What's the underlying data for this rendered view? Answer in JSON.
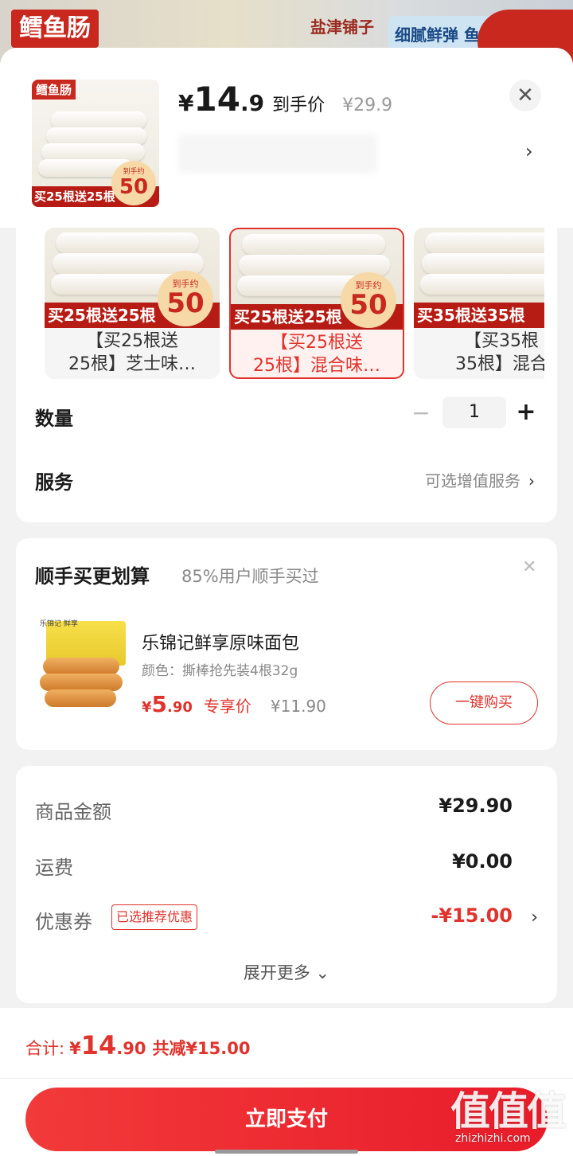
{
  "background": {
    "brand_label": "鳕鱼肠",
    "logo_text": "盐津铺子",
    "tag_text": "细腻鲜弹 鱼"
  },
  "header": {
    "thumb_brand": "鳕鱼肠",
    "thumb_promo": "买25根送25根",
    "thumb_circle_small": "到手约",
    "thumb_circle_big": "50",
    "price_currency": "¥",
    "price_int": "14",
    "price_dec": ".9",
    "price_label": "到手价",
    "original_price": "¥29.9",
    "close_icon": "✕",
    "chevron_icon": "›"
  },
  "sku_options": [
    {
      "promo": "买25根送25根",
      "circle_small": "到手约",
      "circle_big": "50",
      "name": "【买25根送\n25根】芝士味…",
      "selected": false
    },
    {
      "promo": "买25根送25根",
      "circle_small": "到手约",
      "circle_big": "50",
      "name": "【买25根送\n25根】混合味…",
      "selected": true
    },
    {
      "promo": "买35根送35根",
      "circle_small": "",
      "circle_big": "",
      "name": "【买35根\n35根】混合",
      "selected": false
    }
  ],
  "quantity": {
    "label": "数量",
    "minus": "−",
    "value": "1",
    "plus": "+"
  },
  "service": {
    "label": "服务",
    "value": "可选增值服务",
    "chevron": "›"
  },
  "addon": {
    "title": "顺手买更划算",
    "subtitle": "85%用户顺手买过",
    "close_icon": "✕",
    "img_logo": "乐锦记 鲜享",
    "name": "乐锦记鲜享原味面包",
    "spec": "颜色：撕棒抢先装4根32g",
    "price_currency": "¥",
    "price_int": "5",
    "price_dec": ".90",
    "price_tag": "专享价",
    "original_price": "¥11.90",
    "buy_label": "一键购买"
  },
  "summary": {
    "rows": [
      {
        "label": "商品金额",
        "value": "¥29.90"
      },
      {
        "label": "运费",
        "value": "¥0.00"
      },
      {
        "label": "优惠券",
        "badge": "已选推荐优惠",
        "value": "-¥15.00",
        "chevron": "›"
      }
    ],
    "expand_label": "展开更多 ⌄"
  },
  "bottom": {
    "total_label": "合计:",
    "total_currency": "¥",
    "total_int": "14",
    "total_dec": ".90",
    "save_text": "共减¥15.00",
    "pay_label": "立即支付"
  },
  "watermark": {
    "glyphs": "值值值",
    "url": "zhizhizhi.com"
  },
  "colors": {
    "accent": "#e0332c",
    "brand_red": "#c8281e",
    "pay_button": "#f23a3a"
  }
}
